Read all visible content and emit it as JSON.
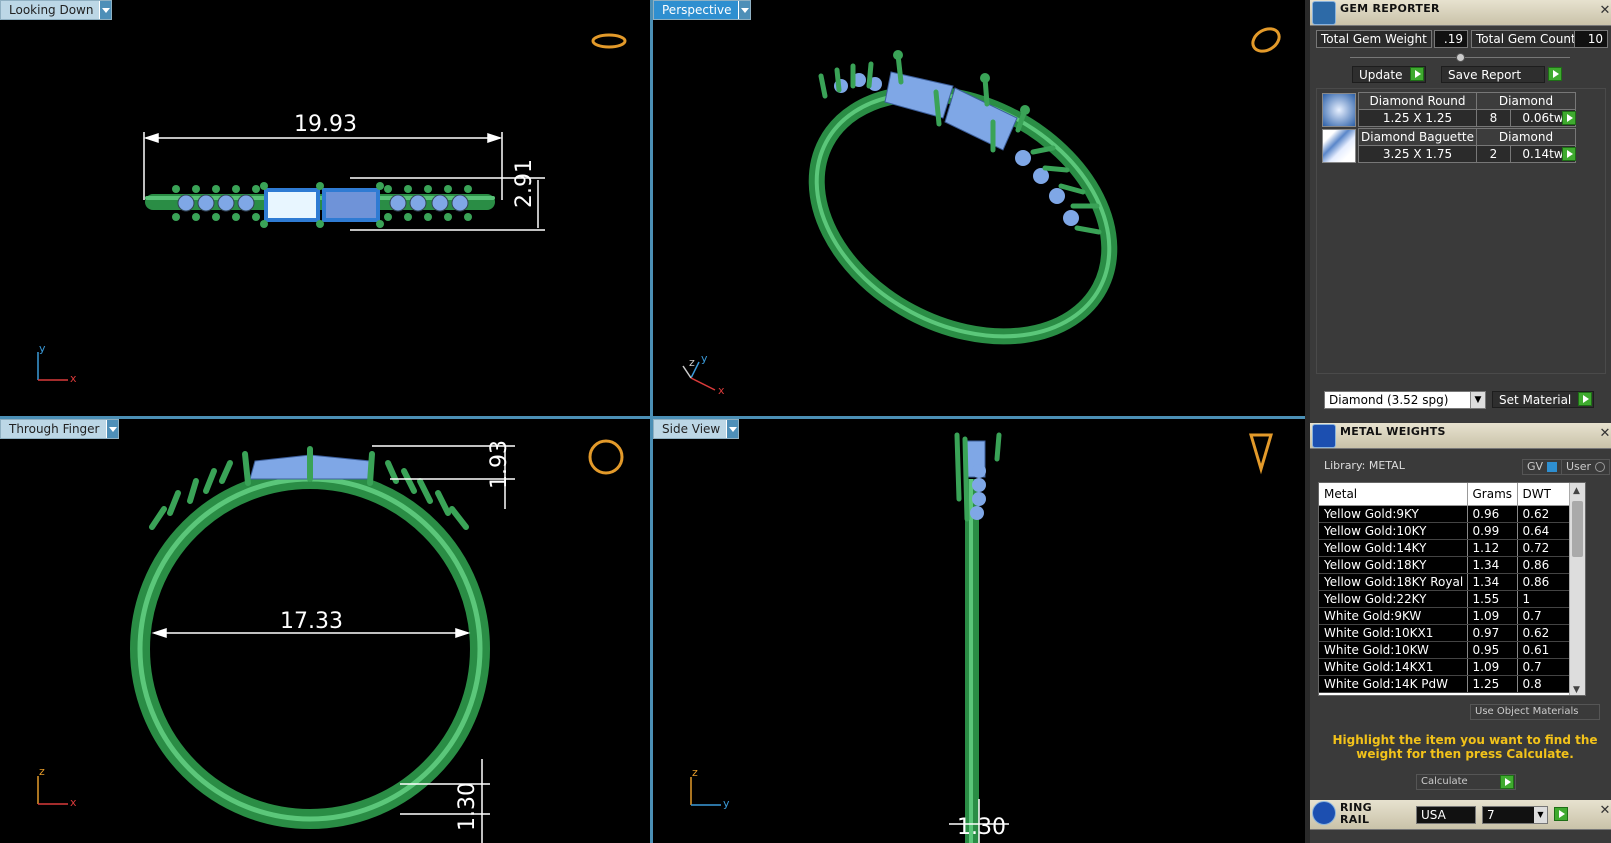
{
  "viewports": {
    "top_left": {
      "label": "Looking Down",
      "dim_width": "19.93",
      "dim_height": "2.91",
      "axis": [
        "y",
        "x"
      ]
    },
    "top_right": {
      "label": "Perspective",
      "axis": [
        "z",
        "y",
        "x"
      ]
    },
    "bottom_left": {
      "label": "Through Finger",
      "dim_top": "1.93",
      "dim_inner": "17.33",
      "dim_bottom": "1.30",
      "axis": [
        "z",
        "x"
      ]
    },
    "bottom_right": {
      "label": "Side View",
      "dim_bottom": "1.30",
      "axis": [
        "z",
        "y"
      ]
    }
  },
  "gem_reporter": {
    "title": "GEM REPORTER",
    "total_weight_label": "Total Gem Weight",
    "total_weight_value": ".19",
    "total_count_label": "Total Gem Count",
    "total_count_value": "10",
    "update_label": "Update",
    "save_report_label": "Save Report",
    "gems": [
      {
        "name": "Diamond Round",
        "material": "Diamond",
        "size": "1.25 X 1.25",
        "count": "8",
        "weight": "0.06tw"
      },
      {
        "name": "Diamond Baguette",
        "material": "Diamond",
        "size": "3.25 X 1.75",
        "count": "2",
        "weight": "0.14tw"
      }
    ],
    "material_select": "Diamond     (3.52 spg)",
    "set_material_label": "Set Material"
  },
  "metal_weights": {
    "title": "METAL WEIGHTS",
    "library_label": "Library: METAL",
    "toggle_gv": "GV",
    "toggle_user": "User",
    "columns": [
      "Metal",
      "Grams",
      "DWT"
    ],
    "rows": [
      [
        "Yellow Gold:9KY",
        "0.96",
        "0.62"
      ],
      [
        "Yellow Gold:10KY",
        "0.99",
        "0.64"
      ],
      [
        "Yellow Gold:14KY",
        "1.12",
        "0.72"
      ],
      [
        "Yellow Gold:18KY",
        "1.34",
        "0.86"
      ],
      [
        "Yellow Gold:18KY Royal",
        "1.34",
        "0.86"
      ],
      [
        "Yellow Gold:22KY",
        "1.55",
        "1"
      ],
      [
        "White Gold:9KW",
        "1.09",
        "0.7"
      ],
      [
        "White Gold:10KX1",
        "0.97",
        "0.62"
      ],
      [
        "White Gold:10KW",
        "0.95",
        "0.61"
      ],
      [
        "White Gold:14KX1",
        "1.09",
        "0.7"
      ],
      [
        "White Gold:14K PdW",
        "1.25",
        "0.8"
      ]
    ],
    "use_object_materials": "Use Object Materials",
    "hint": "Highlight the item you want to find the weight for then press Calculate.",
    "calculate_label": "Calculate"
  },
  "ring_rail": {
    "title": "RING RAIL",
    "region": "USA",
    "size": "7"
  },
  "colors": {
    "metal": "#2f9a4c",
    "gem": "#7fa7e6",
    "dimension": "#ffffff",
    "accent": "#2e8fd0"
  }
}
